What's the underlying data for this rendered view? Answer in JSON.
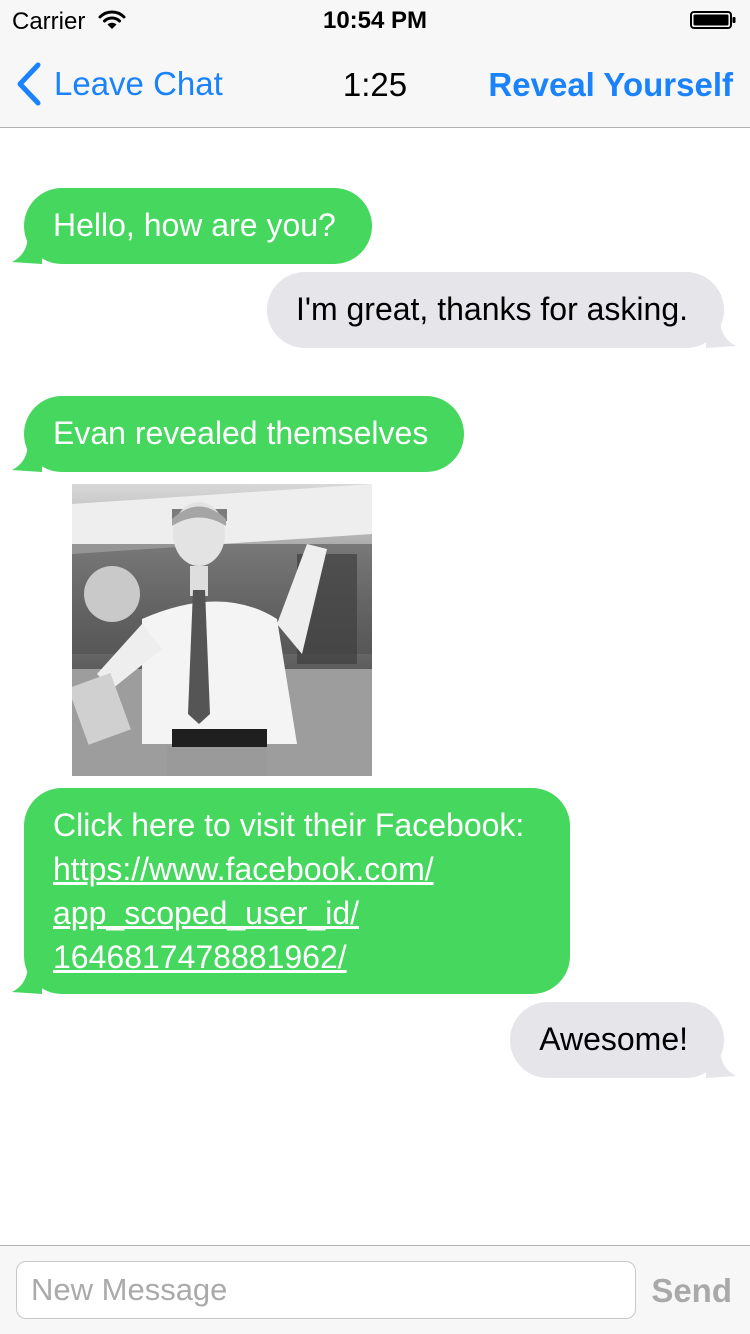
{
  "status_bar": {
    "carrier": "Carrier",
    "time": "10:54 PM"
  },
  "nav": {
    "back_label": "Leave Chat",
    "title": "1:25",
    "action_label": "Reveal Yourself"
  },
  "messages": [
    {
      "side": "in",
      "text": "Hello, how are you?"
    },
    {
      "side": "out",
      "text": "I'm great, thanks for asking."
    },
    {
      "side": "in",
      "text": "Evan revealed themselves"
    },
    {
      "side": "in",
      "text": "Click here to visit their Facebook:",
      "link_lines": [
        "https://www.facebook.com/",
        "app_scoped_user_id/",
        "1646817478881962/"
      ]
    },
    {
      "side": "out",
      "text": "Awesome!"
    }
  ],
  "composer": {
    "placeholder": "New Message",
    "send_label": "Send"
  },
  "colors": {
    "accent": "#1a82fb",
    "incoming_bubble": "#45d75e",
    "outgoing_bubble": "#e5e5ea"
  },
  "icons": {
    "back": "chevron-left-icon",
    "wifi": "wifi-icon",
    "battery": "battery-icon"
  }
}
